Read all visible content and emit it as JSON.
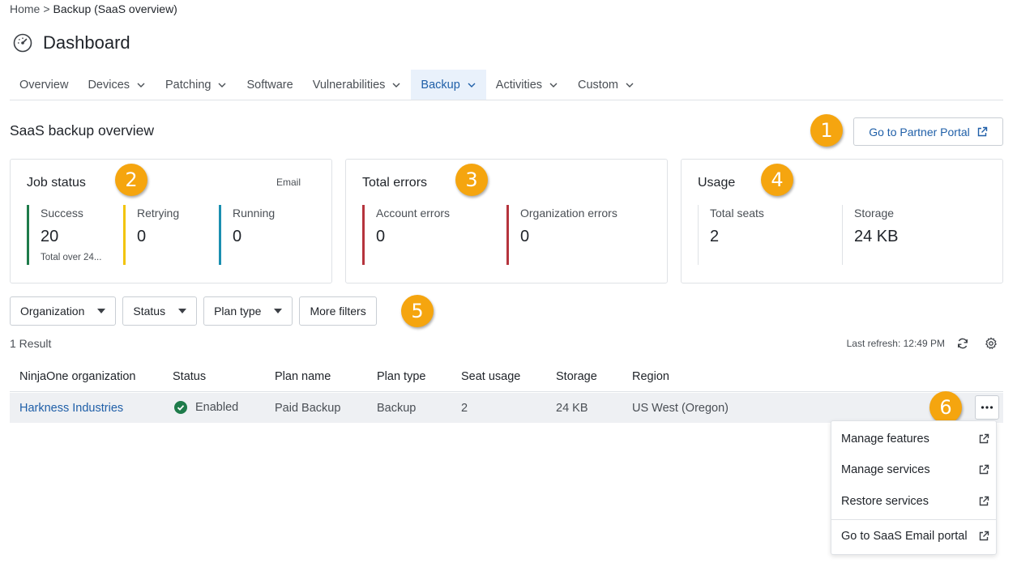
{
  "breadcrumb": {
    "home": "Home",
    "separator": ">",
    "current": "Backup (SaaS overview)"
  },
  "page": {
    "title": "Dashboard",
    "icon": "dashboard-gauge-icon"
  },
  "tabs": [
    {
      "label": "Overview",
      "dropdown": false,
      "active": false
    },
    {
      "label": "Devices",
      "dropdown": true,
      "active": false
    },
    {
      "label": "Patching",
      "dropdown": true,
      "active": false
    },
    {
      "label": "Software",
      "dropdown": false,
      "active": false
    },
    {
      "label": "Vulnerabilities",
      "dropdown": true,
      "active": false
    },
    {
      "label": "Backup",
      "dropdown": true,
      "active": true
    },
    {
      "label": "Activities",
      "dropdown": true,
      "active": false
    },
    {
      "label": "Custom",
      "dropdown": true,
      "active": false
    }
  ],
  "section": {
    "title": "SaaS backup overview"
  },
  "partner_button": {
    "label": "Go to Partner Portal",
    "icon": "external-link-icon"
  },
  "cards": {
    "job_status": {
      "title": "Job status",
      "aux": "Email",
      "metrics": [
        {
          "label": "Success",
          "value": "20",
          "sub": "Total over 24...",
          "color": "#1e7b4a"
        },
        {
          "label": "Retrying",
          "value": "0",
          "color": "#f2c40c"
        },
        {
          "label": "Running",
          "value": "0",
          "color": "#1a8fb0"
        }
      ]
    },
    "total_errors": {
      "title": "Total errors",
      "metrics": [
        {
          "label": "Account errors",
          "value": "0",
          "color": "#b5343d"
        },
        {
          "label": "Organization errors",
          "value": "0",
          "color": "#b5343d"
        }
      ]
    },
    "usage": {
      "title": "Usage",
      "metrics": [
        {
          "label": "Total seats",
          "value": "2"
        },
        {
          "label": "Storage",
          "value": "24 KB"
        }
      ]
    }
  },
  "callouts": [
    "1",
    "2",
    "3",
    "4",
    "5",
    "6"
  ],
  "callout_color": "#f5a50f",
  "filters": [
    {
      "label": "Organization",
      "caret": true
    },
    {
      "label": "Status",
      "caret": true
    },
    {
      "label": "Plan type",
      "caret": true
    },
    {
      "label": "More filters",
      "caret": false
    }
  ],
  "results": {
    "count": "1 Result",
    "last_refresh": "Last refresh: 12:49 PM"
  },
  "table": {
    "columns": [
      "NinjaOne organization",
      "Status",
      "Plan name",
      "Plan type",
      "Seat usage",
      "Storage",
      "Region"
    ],
    "rows": [
      {
        "organization": "Harkness Industries",
        "status": "Enabled",
        "plan_name": "Paid Backup",
        "plan_type": "Backup",
        "seat_usage": "2",
        "storage": "24 KB",
        "region": "US West (Oregon)"
      }
    ]
  },
  "row_menu": {
    "items": [
      {
        "label": "Manage features",
        "icon": "external-link-icon"
      },
      {
        "label": "Manage services",
        "icon": "external-link-icon"
      },
      {
        "label": "Restore services",
        "icon": "external-link-icon"
      },
      {
        "label": "Go to SaaS Email portal",
        "icon": "external-link-icon"
      }
    ]
  }
}
